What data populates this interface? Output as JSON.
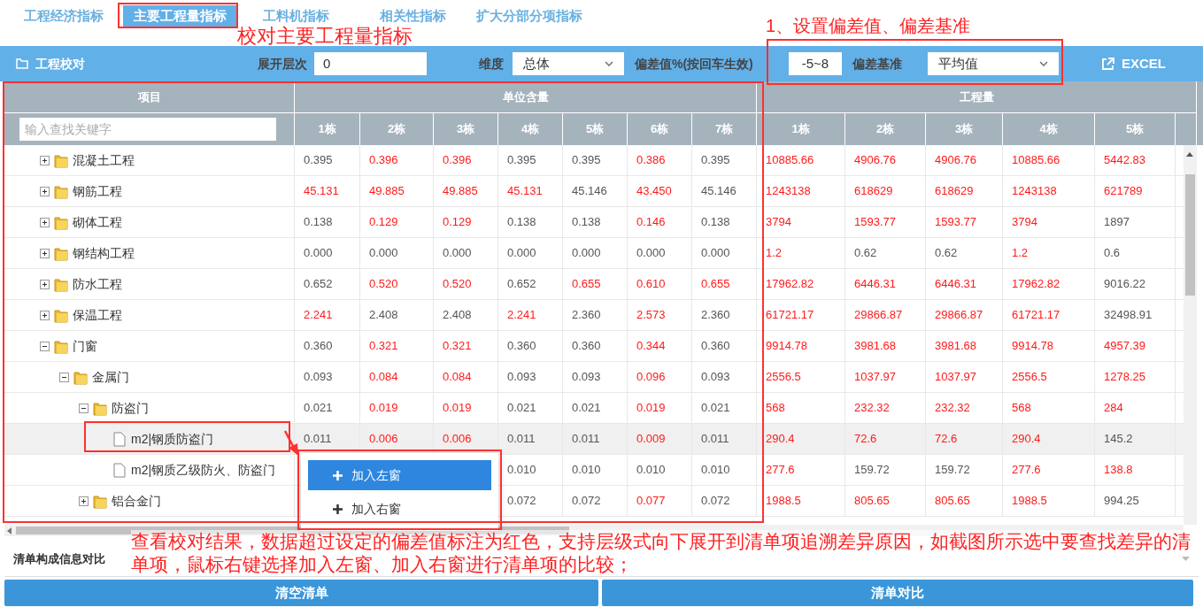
{
  "tabs": [
    {
      "label": "工程经济指标",
      "selected": false
    },
    {
      "label": "主要工程量指标",
      "selected": true
    },
    {
      "label": "工料机指标",
      "selected": false
    },
    {
      "label": "相关性指标",
      "selected": false
    },
    {
      "label": "扩大分部分项指标",
      "selected": false
    }
  ],
  "toolbar": {
    "title": "工程校对",
    "expand_level": {
      "label": "展开层次",
      "value": "0"
    },
    "dimension": {
      "label": "维度",
      "value": "总体"
    },
    "deviation": {
      "label": "偏差值%(按回车生效)",
      "value": "-5~8"
    },
    "baseline": {
      "label": "偏差基准",
      "value": "平均值"
    },
    "export": "EXCEL"
  },
  "table": {
    "group_headers": [
      "项目",
      "单位含量",
      "工程量"
    ],
    "search": {
      "placeholder": "输入查找关键字"
    },
    "unit_columns": [
      "1栋",
      "2栋",
      "3栋",
      "4栋",
      "5栋",
      "6栋",
      "7栋"
    ],
    "quantity_columns": [
      "1栋",
      "2栋",
      "3栋",
      "4栋",
      "5栋"
    ],
    "rows": [
      {
        "label": "混凝土工程",
        "kind": "folder",
        "expanded": false,
        "selected": false,
        "unit": [
          "0.395",
          "0.396",
          "0.396",
          "0.395",
          "0.395",
          "0.386",
          "0.395"
        ],
        "unit_over": [
          false,
          true,
          true,
          false,
          false,
          true,
          false
        ],
        "quantity": [
          "10885.66",
          "4906.76",
          "4906.76",
          "10885.66",
          "5442.83"
        ],
        "quantity_over": [
          true,
          true,
          true,
          true,
          true
        ]
      },
      {
        "label": "钢筋工程",
        "kind": "folder",
        "expanded": false,
        "selected": false,
        "unit": [
          "45.131",
          "49.885",
          "49.885",
          "45.131",
          "45.146",
          "43.450",
          "45.146"
        ],
        "unit_over": [
          true,
          true,
          true,
          true,
          false,
          true,
          false
        ],
        "quantity": [
          "1243138",
          "618629",
          "618629",
          "1243138",
          "621789"
        ],
        "quantity_over": [
          true,
          true,
          true,
          true,
          true
        ]
      },
      {
        "label": "砌体工程",
        "kind": "folder",
        "expanded": false,
        "selected": false,
        "unit": [
          "0.138",
          "0.129",
          "0.129",
          "0.138",
          "0.138",
          "0.146",
          "0.138"
        ],
        "unit_over": [
          false,
          true,
          true,
          false,
          false,
          true,
          false
        ],
        "quantity": [
          "3794",
          "1593.77",
          "1593.77",
          "3794",
          "1897"
        ],
        "quantity_over": [
          true,
          true,
          true,
          true,
          false
        ]
      },
      {
        "label": "钢结构工程",
        "kind": "folder",
        "expanded": false,
        "selected": false,
        "unit": [
          "0.000",
          "0.000",
          "0.000",
          "0.000",
          "0.000",
          "0.000",
          "0.000"
        ],
        "unit_over": [
          false,
          false,
          false,
          false,
          false,
          false,
          false
        ],
        "quantity": [
          "1.2",
          "0.62",
          "0.62",
          "1.2",
          "0.6"
        ],
        "quantity_over": [
          true,
          false,
          false,
          true,
          false
        ]
      },
      {
        "label": "防水工程",
        "kind": "folder",
        "expanded": false,
        "selected": false,
        "unit": [
          "0.652",
          "0.520",
          "0.520",
          "0.652",
          "0.655",
          "0.610",
          "0.655"
        ],
        "unit_over": [
          false,
          true,
          true,
          false,
          true,
          true,
          true
        ],
        "quantity": [
          "17962.82",
          "6446.31",
          "6446.31",
          "17962.82",
          "9016.22"
        ],
        "quantity_over": [
          true,
          true,
          true,
          true,
          false
        ]
      },
      {
        "label": "保温工程",
        "kind": "folder",
        "expanded": false,
        "selected": false,
        "unit": [
          "2.241",
          "2.408",
          "2.408",
          "2.241",
          "2.360",
          "2.573",
          "2.360"
        ],
        "unit_over": [
          true,
          false,
          false,
          true,
          false,
          true,
          false
        ],
        "quantity": [
          "61721.17",
          "29866.87",
          "29866.87",
          "61721.17",
          "32498.91"
        ],
        "quantity_over": [
          true,
          true,
          true,
          true,
          false
        ]
      },
      {
        "label": "门窗",
        "kind": "folder",
        "expanded": true,
        "selected": false,
        "unit": [
          "0.360",
          "0.321",
          "0.321",
          "0.360",
          "0.360",
          "0.344",
          "0.360"
        ],
        "unit_over": [
          false,
          true,
          true,
          false,
          false,
          true,
          false
        ],
        "quantity": [
          "9914.78",
          "3981.68",
          "3981.68",
          "9914.78",
          "4957.39"
        ],
        "quantity_over": [
          true,
          true,
          true,
          true,
          true
        ],
        "children": [
          {
            "label": "金属门",
            "kind": "folder",
            "expanded": true,
            "selected": false,
            "unit": [
              "0.093",
              "0.084",
              "0.084",
              "0.093",
              "0.093",
              "0.096",
              "0.093"
            ],
            "unit_over": [
              false,
              true,
              true,
              false,
              false,
              true,
              false
            ],
            "quantity": [
              "2556.5",
              "1037.97",
              "1037.97",
              "2556.5",
              "1278.25"
            ],
            "quantity_over": [
              true,
              true,
              true,
              true,
              true
            ],
            "children": [
              {
                "label": "防盗门",
                "kind": "folder",
                "expanded": true,
                "selected": false,
                "unit": [
                  "0.021",
                  "0.019",
                  "0.019",
                  "0.021",
                  "0.021",
                  "0.019",
                  "0.021"
                ],
                "unit_over": [
                  false,
                  true,
                  true,
                  false,
                  false,
                  true,
                  false
                ],
                "quantity": [
                  "568",
                  "232.32",
                  "232.32",
                  "568",
                  "284"
                ],
                "quantity_over": [
                  true,
                  true,
                  true,
                  true,
                  true
                ],
                "children": [
                  {
                    "label": "m2|钢质防盗门",
                    "kind": "item",
                    "selected": true,
                    "unit": [
                      "0.011",
                      "0.006",
                      "0.006",
                      "0.011",
                      "0.011",
                      "0.009",
                      "0.011"
                    ],
                    "unit_over": [
                      false,
                      true,
                      true,
                      false,
                      false,
                      true,
                      false
                    ],
                    "quantity": [
                      "290.4",
                      "72.6",
                      "72.6",
                      "290.4",
                      "145.2"
                    ],
                    "quantity_over": [
                      true,
                      true,
                      true,
                      true,
                      false
                    ]
                  },
                  {
                    "label": "m2|钢质乙级防火、防盗门",
                    "kind": "item",
                    "selected": false,
                    "menu_covered": true,
                    "unit": [
                      "0.010",
                      "0.010",
                      "0.010",
                      "0.010"
                    ],
                    "unit_over": [
                      false,
                      false,
                      false,
                      false
                    ],
                    "quantity": [
                      "277.6",
                      "159.72",
                      "159.72",
                      "277.6",
                      "138.8"
                    ],
                    "quantity_over": [
                      true,
                      false,
                      false,
                      true,
                      true
                    ]
                  }
                ]
              },
              {
                "label": "铝合金门",
                "kind": "folder",
                "expanded": false,
                "selected": false,
                "menu_covered": true,
                "unit": [
                  "0.072",
                  "0.072",
                  "0.077",
                  "0.072"
                ],
                "unit_over": [
                  false,
                  false,
                  true,
                  false
                ],
                "quantity": [
                  "1988.5",
                  "805.65",
                  "805.65",
                  "1988.5",
                  "994.25"
                ],
                "quantity_over": [
                  true,
                  true,
                  true,
                  true,
                  false
                ]
              }
            ]
          }
        ]
      }
    ]
  },
  "context_menu": [
    {
      "label": "加入左窗",
      "selected": true
    },
    {
      "label": "加入右窗",
      "selected": false
    }
  ],
  "section_label": "清单构成信息对比",
  "buttons": [
    "清空清单",
    "清单对比"
  ],
  "annotations": [
    {
      "kind": "tab_note",
      "text": "校对主要工程量指标"
    },
    {
      "kind": "setting_note",
      "text": "1、设置偏差值、偏差基准"
    },
    {
      "kind": "result_note",
      "text": "查看校对结果，数据超过设定的偏差值标注为红色，支持层级式向下展开到清单项追溯差异原因，如截图所示选中要查找差异的清单项，鼠标右键选择加入左窗、加入右窗进行清单项的比较；"
    }
  ]
}
